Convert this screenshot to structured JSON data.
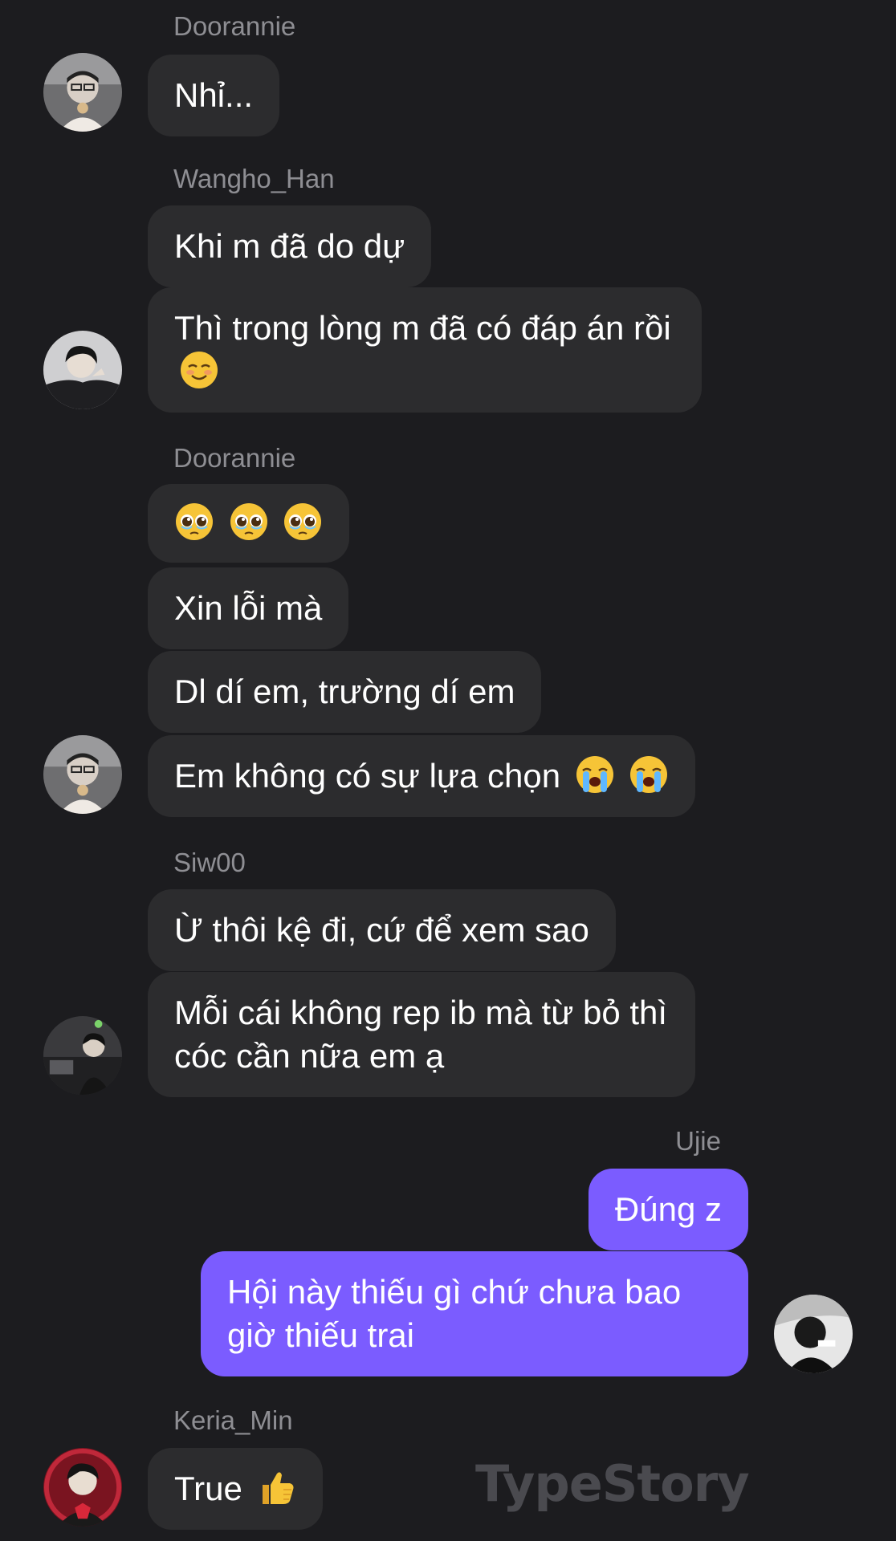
{
  "messages": [
    {
      "sender": "Doorannie",
      "texts": [
        "Nhỉ..."
      ]
    },
    {
      "sender": "Wangho_Han",
      "texts": [
        "Khi m đã do dự",
        "Thì trong lòng m đã có đáp án rồi"
      ]
    },
    {
      "sender": "Doorannie",
      "texts": [
        "",
        "Xin lỗi mà",
        "Dl dí em, trường dí em",
        "Em không có sự lựa chọn"
      ]
    },
    {
      "sender": "Siw00",
      "texts": [
        "Ừ thôi kệ đi, cứ để xem sao",
        "Mỗi cái không rep ib mà từ bỏ thì cóc cần nữa em ạ"
      ]
    },
    {
      "sender": "Ujie",
      "texts": [
        "Đúng z",
        "Hội này thiếu gì chứ chưa bao giờ thiếu trai"
      ]
    },
    {
      "sender": "Keria_Min",
      "texts": [
        "True"
      ]
    }
  ],
  "watermark": "TypeStory",
  "colors": {
    "background": "#1c1c1f",
    "incoming_bubble": "#2c2c2e",
    "outgoing_bubble": "#7b5cff",
    "sender_name": "#8e8e93"
  },
  "emoji_icons": {
    "m2_line2": "smiling-face-icon",
    "m3_bubble1": [
      "pleading-face-icon",
      "pleading-face-icon",
      "pleading-face-icon"
    ],
    "m3_bubble4": [
      "loudly-crying-face-icon",
      "loudly-crying-face-icon"
    ],
    "m6_bubble1": "thumbs-up-icon"
  }
}
